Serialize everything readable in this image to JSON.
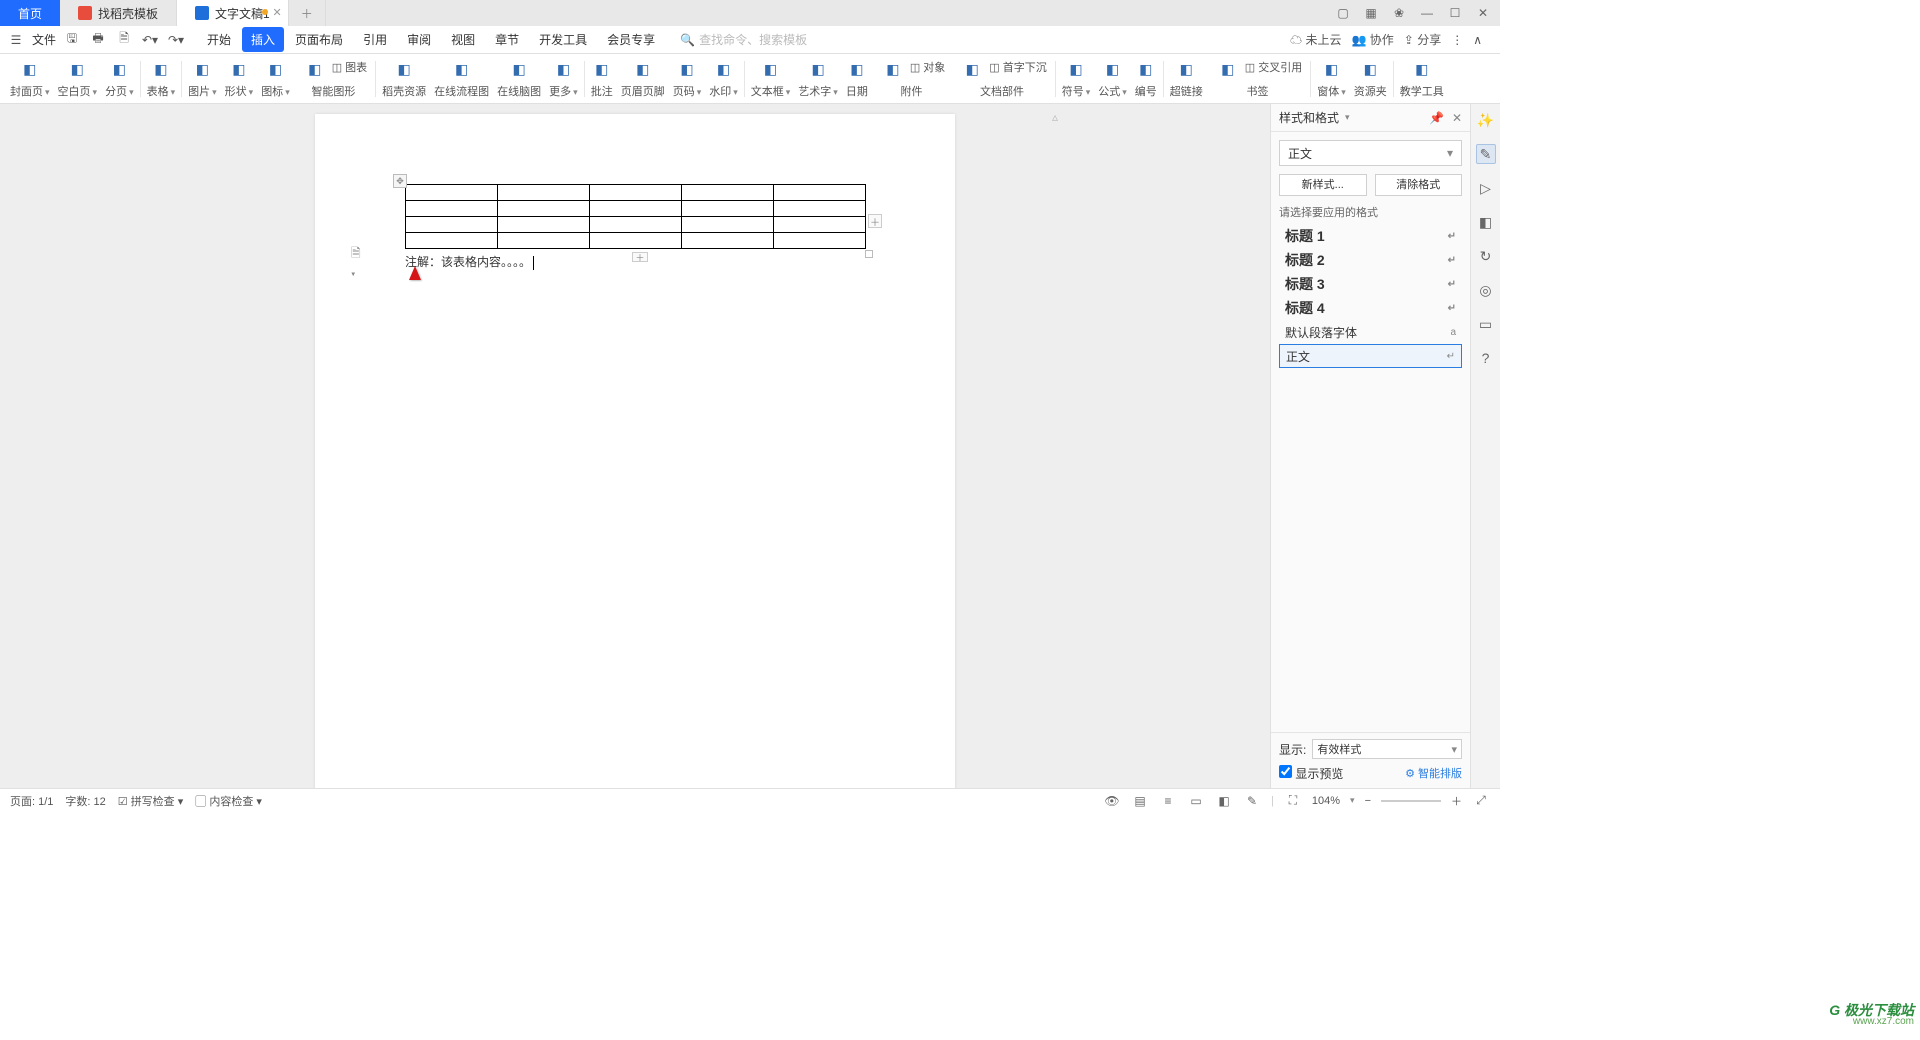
{
  "tabs": {
    "home": "首页",
    "templates": "找稻壳模板",
    "doc": "文字文稿1"
  },
  "menu": {
    "file": "文件",
    "list": [
      "开始",
      "插入",
      "页面布局",
      "引用",
      "审阅",
      "视图",
      "章节",
      "开发工具",
      "会员专享"
    ],
    "activeIndex": 1,
    "search_placeholder": "查找命令、搜索模板",
    "right": {
      "cloud": "未上云",
      "coop": "协作",
      "share": "分享"
    }
  },
  "ribbon": [
    {
      "label": "封面页",
      "drop": true
    },
    {
      "label": "空白页",
      "drop": true
    },
    {
      "label": "分页",
      "drop": true
    },
    {
      "sep": true
    },
    {
      "label": "表格",
      "drop": true
    },
    {
      "sep": true
    },
    {
      "label": "图片",
      "drop": true
    },
    {
      "label": "形状",
      "drop": true
    },
    {
      "label": "图标",
      "drop": true
    },
    {
      "label": "智能图形",
      "side": "图表"
    },
    {
      "sep": true
    },
    {
      "label": "稻壳资源"
    },
    {
      "label": "在线流程图"
    },
    {
      "label": "在线脑图"
    },
    {
      "label": "更多",
      "drop": true
    },
    {
      "sep": true
    },
    {
      "label": "批注"
    },
    {
      "label": "页眉页脚"
    },
    {
      "label": "页码",
      "drop": true
    },
    {
      "label": "水印",
      "drop": true
    },
    {
      "sep": true
    },
    {
      "label": "文本框",
      "drop": true
    },
    {
      "label": "艺术字",
      "drop": true
    },
    {
      "label": "日期"
    },
    {
      "label": "附件",
      "side": "对象"
    },
    {
      "label": "文档部件",
      "drop": true,
      "side": "首字下沉"
    },
    {
      "sep": true
    },
    {
      "label": "符号",
      "drop": true
    },
    {
      "label": "公式",
      "drop": true
    },
    {
      "label": "编号"
    },
    {
      "sep": true
    },
    {
      "label": "超链接"
    },
    {
      "label": "书签",
      "side": "交叉引用"
    },
    {
      "sep": true
    },
    {
      "label": "窗体",
      "drop": true
    },
    {
      "label": "资源夹"
    },
    {
      "sep": true
    },
    {
      "label": "教学工具"
    }
  ],
  "document": {
    "caption": "注解：该表格内容。。。。"
  },
  "panel": {
    "title": "样式和格式",
    "current": "正文",
    "new_btn": "新样式...",
    "clear_btn": "清除格式",
    "prompt": "请选择要应用的格式",
    "styles": [
      "标题 1",
      "标题 2",
      "标题 3",
      "标题 4",
      "默认段落字体",
      "正文"
    ],
    "display_label": "显示:",
    "display_value": "有效样式",
    "preview": "显示预览",
    "smart": "智能排版"
  },
  "status": {
    "page": "页面: 1/1",
    "words": "字数: 12",
    "spell": "拼写检查",
    "content": "内容检查",
    "zoom": "104%"
  },
  "watermark": {
    "line1": "极光下载站",
    "line2": "www.xz7.com"
  }
}
